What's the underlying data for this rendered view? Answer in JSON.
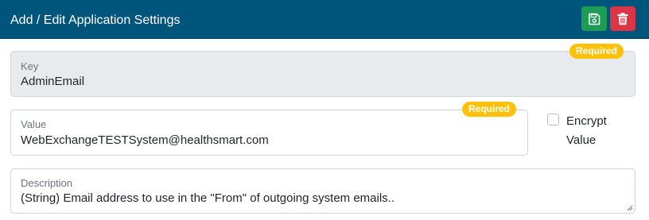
{
  "header": {
    "title": "Add / Edit Application Settings",
    "save_icon": "floppy-disk-icon",
    "delete_icon": "trash-icon",
    "save_color": "#1e9b55",
    "delete_color": "#dc3545",
    "bar_color": "#00557d"
  },
  "key": {
    "label": "Key",
    "value": "AdminEmail",
    "badge": "Required"
  },
  "value": {
    "label": "Value",
    "value": "WebExchangeTESTSystem@healthsmart.com",
    "badge": "Required"
  },
  "encrypt": {
    "label": "Encrypt Value",
    "checked": false
  },
  "description": {
    "label": "Description",
    "value": "(String) Email address to use in the \"From\" of outgoing system emails.."
  }
}
